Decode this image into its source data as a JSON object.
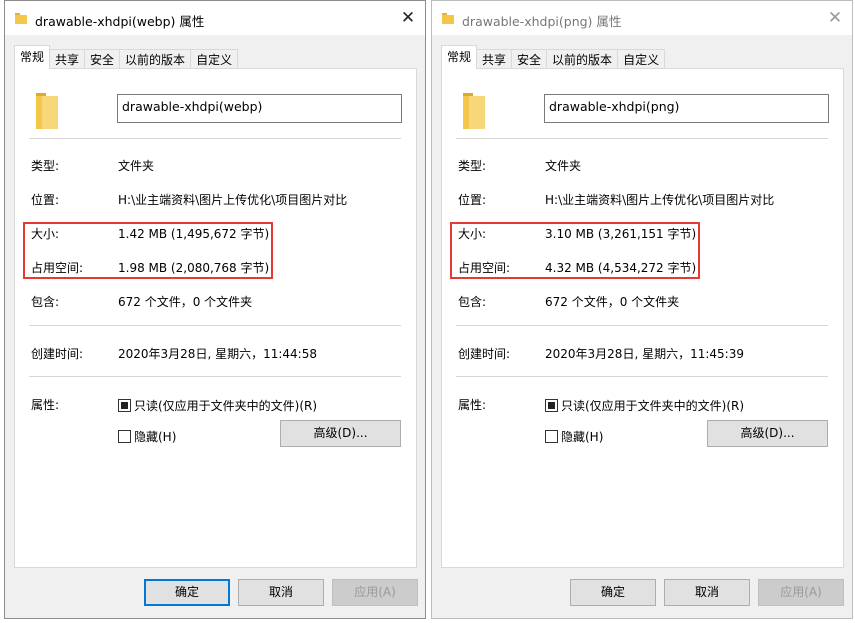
{
  "dialogs": {
    "left": {
      "title": "drawable-xhdpi(webp) 属性",
      "tabs": [
        "常规",
        "共享",
        "安全",
        "以前的版本",
        "自定义"
      ],
      "folder_name": "drawable-xhdpi(webp)",
      "type_label": "类型:",
      "type_value": "文件夹",
      "location_label": "位置:",
      "location_value": "H:\\业主端资料\\图片上传优化\\项目图片对比",
      "size_label": "大小:",
      "size_value": "1.42 MB (1,495,672 字节)",
      "disk_label": "占用空间:",
      "disk_value": "1.98 MB (2,080,768 字节)",
      "contains_label": "包含:",
      "contains_value": "672 个文件，0 个文件夹",
      "created_label": "创建时间:",
      "created_value": "2020年3月28日, 星期六，11:44:58",
      "attr_label": "属性:",
      "readonly_label": "只读(仅应用于文件夹中的文件)(R)",
      "hidden_label": "隐藏(H)",
      "advanced_label": "高级(D)...",
      "ok_label": "确定",
      "cancel_label": "取消",
      "apply_label": "应用(A)"
    },
    "right": {
      "title": "drawable-xhdpi(png) 属性",
      "tabs": [
        "常规",
        "共享",
        "安全",
        "以前的版本",
        "自定义"
      ],
      "folder_name": "drawable-xhdpi(png)",
      "type_label": "类型:",
      "type_value": "文件夹",
      "location_label": "位置:",
      "location_value": "H:\\业主端资料\\图片上传优化\\项目图片对比",
      "size_label": "大小:",
      "size_value": "3.10 MB (3,261,151 字节)",
      "disk_label": "占用空间:",
      "disk_value": "4.32 MB (4,534,272 字节)",
      "contains_label": "包含:",
      "contains_value": "672 个文件，0 个文件夹",
      "created_label": "创建时间:",
      "created_value": "2020年3月28日, 星期六，11:45:39",
      "attr_label": "属性:",
      "readonly_label": "只读(仅应用于文件夹中的文件)(R)",
      "hidden_label": "隐藏(H)",
      "advanced_label": "高级(D)...",
      "ok_label": "确定",
      "cancel_label": "取消",
      "apply_label": "应用(A)"
    }
  },
  "icons": {
    "close": "close-icon",
    "folder": "folder-icon"
  },
  "colors": {
    "highlight": "#e53935",
    "focus": "#0078d7",
    "folder": "#f4c74a"
  }
}
